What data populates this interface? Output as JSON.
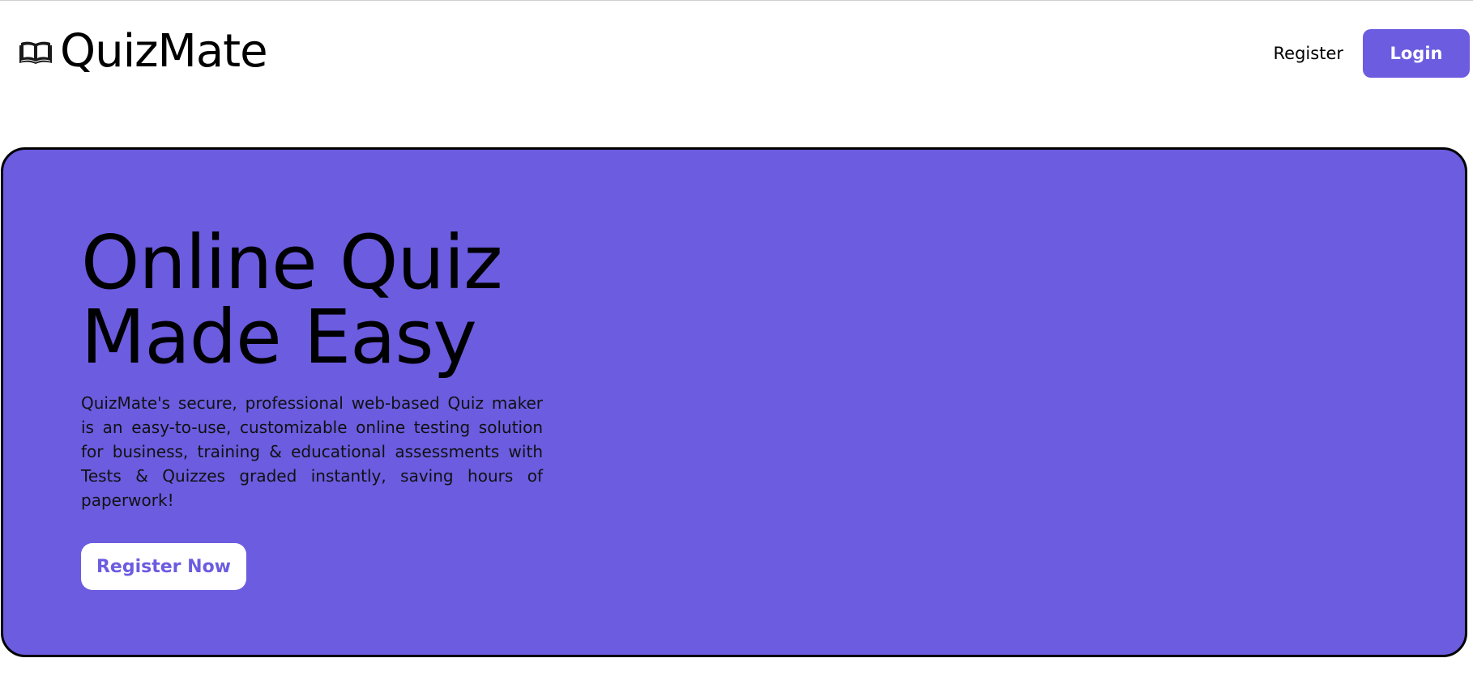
{
  "brand": {
    "name": "QuizMate",
    "icon": "open-book-icon"
  },
  "nav": {
    "register_label": "Register",
    "login_label": "Login"
  },
  "hero": {
    "title_line1": "Online Quiz",
    "title_line2": "Made Easy",
    "description": "QuizMate's secure, professional web-based Quiz maker is an easy-to-use, customizable online testing solution for business, training & educational assessments with Tests & Quizzes graded instantly, saving hours of paperwork!",
    "cta_label": "Register Now"
  },
  "colors": {
    "accent": "#6b5ce0",
    "text": "#000000",
    "background": "#ffffff"
  }
}
